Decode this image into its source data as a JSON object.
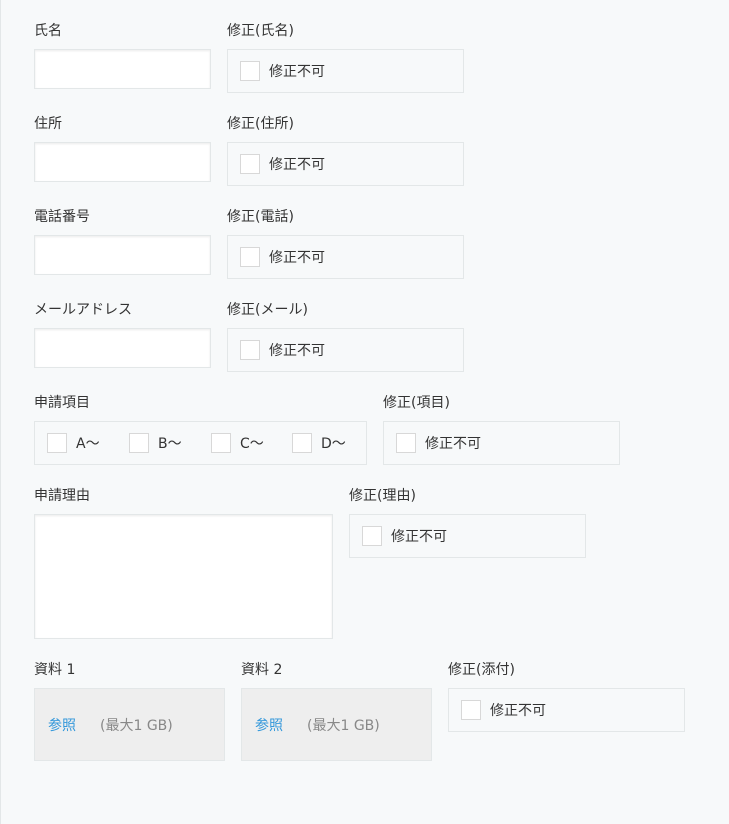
{
  "fields": {
    "name": {
      "label": "氏名",
      "value": ""
    },
    "address": {
      "label": "住所",
      "value": ""
    },
    "phone": {
      "label": "電話番号",
      "value": ""
    },
    "email": {
      "label": "メールアドレス",
      "value": ""
    },
    "items": {
      "label": "申請項目",
      "options": [
        "A〜",
        "B〜",
        "C〜",
        "D〜"
      ]
    },
    "reason": {
      "label": "申請理由",
      "value": ""
    },
    "file1": {
      "label": "資料 1",
      "browse": "参照",
      "max_size": "(最大1 GB)"
    },
    "file2": {
      "label": "資料 2",
      "browse": "参照",
      "max_size": "(最大1 GB)"
    }
  },
  "modify": {
    "name_label": "修正(氏名)",
    "address_label": "修正(住所)",
    "phone_label": "修正(電話)",
    "email_label": "修正(メール)",
    "items_label": "修正(項目)",
    "reason_label": "修正(理由)",
    "attach_label": "修正(添付)",
    "not_modifiable": "修正不可"
  },
  "colors": {
    "background": "#f7f9fa",
    "border": "#e3e7e8",
    "link": "#3498db",
    "file_box": "#eeeeee"
  }
}
